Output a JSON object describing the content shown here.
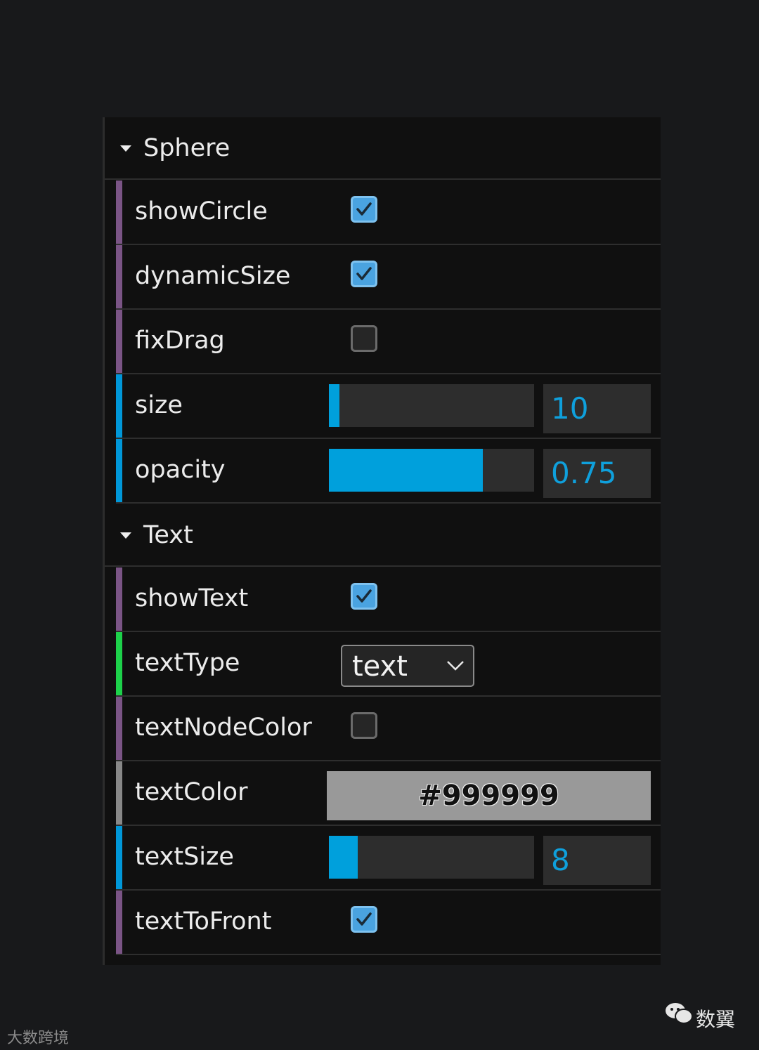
{
  "colors": {
    "background": "#18191b",
    "panel": "#101010",
    "boolean_bar": "#7a5485",
    "number_bar": "#0097d8",
    "string_bar": "#1dd14a",
    "color_bar": "#888888",
    "slider_fill": "#00a0dc",
    "number_text": "#0fa0dc",
    "checkbox_on": "#4aa3e0"
  },
  "folders": [
    {
      "title": "Sphere",
      "arrow_icon": "triangle-down-icon"
    },
    {
      "title": "Text",
      "arrow_icon": "triangle-down-icon"
    }
  ],
  "sphere": {
    "showCircle": {
      "label": "showCircle",
      "checked": true
    },
    "dynamicSize": {
      "label": "dynamicSize",
      "checked": true
    },
    "fixDrag": {
      "label": "fixDrag",
      "checked": false
    },
    "size": {
      "label": "size",
      "value": "10",
      "fill": 0.05
    },
    "opacity": {
      "label": "opacity",
      "value": "0.75",
      "fill": 0.75
    }
  },
  "text": {
    "showText": {
      "label": "showText",
      "checked": true
    },
    "textType": {
      "label": "textType",
      "value": "text"
    },
    "textNodeColor": {
      "label": "textNodeColor",
      "checked": false
    },
    "textColor": {
      "label": "textColor",
      "value": "#999999",
      "swatch": "#999999"
    },
    "textSize": {
      "label": "textSize",
      "value": "8",
      "fill": 0.14
    },
    "textToFront": {
      "label": "textToFront",
      "checked": true
    }
  },
  "watermarks": {
    "left": "大数跨境",
    "right": "数翼"
  }
}
